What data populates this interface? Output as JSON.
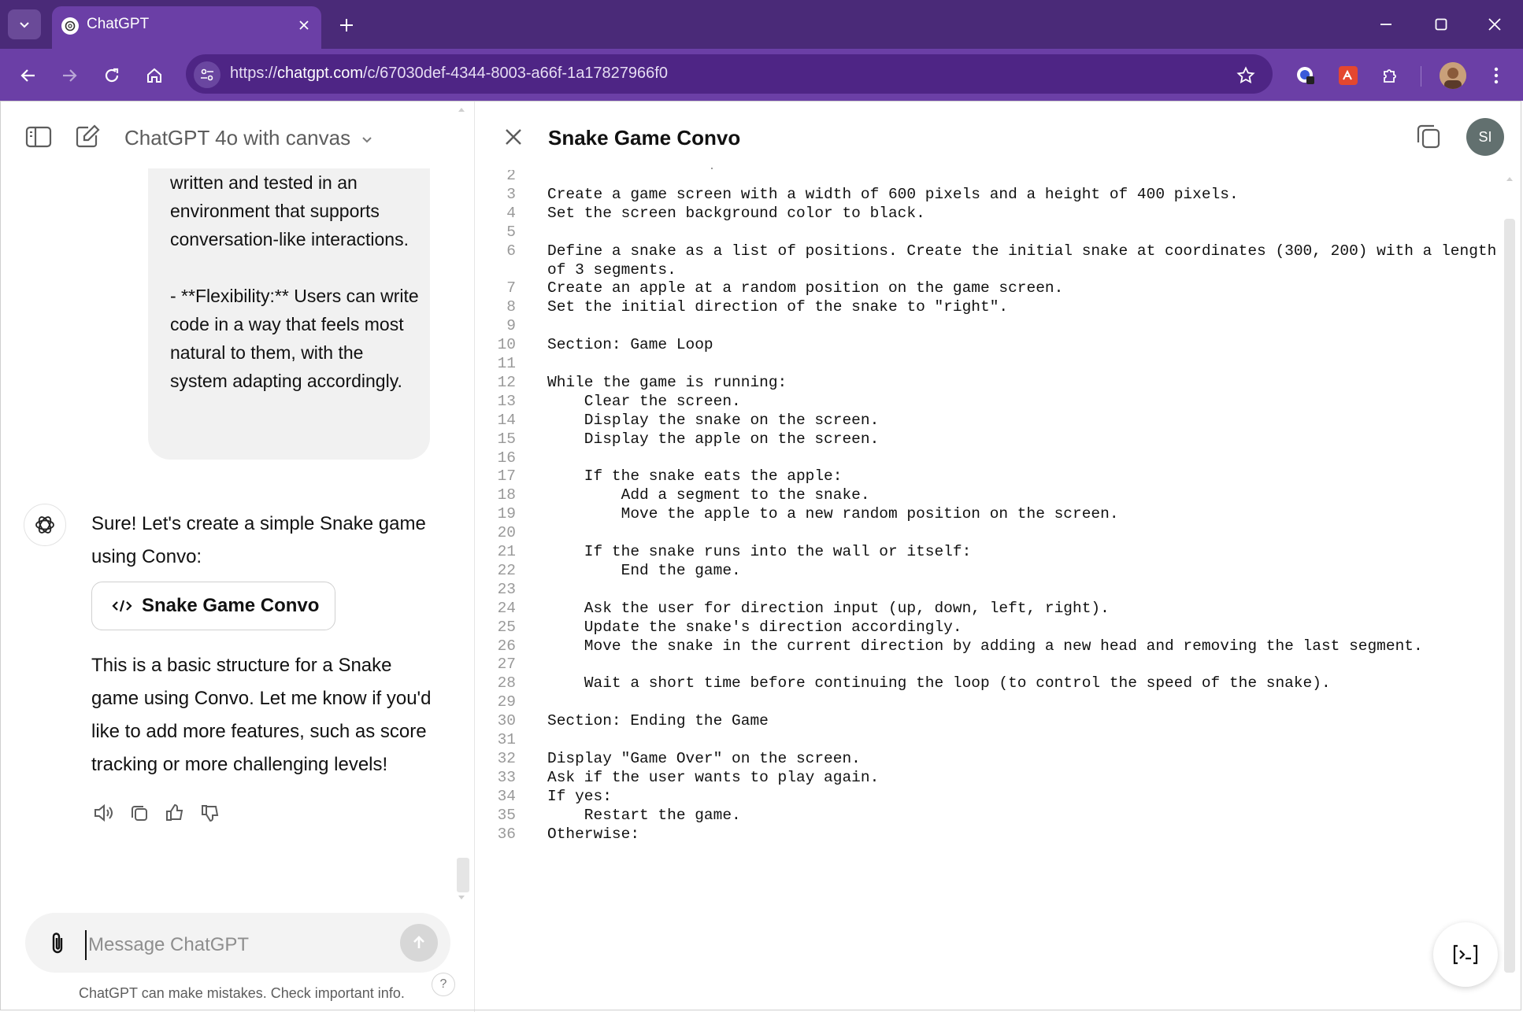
{
  "browser": {
    "tab_title": "ChatGPT",
    "url_prefix": "https://",
    "url_host": "chatgpt.com",
    "url_path": "/c/67030def-4344-8003-a66f-1a17827966f0"
  },
  "chat": {
    "model_title": "ChatGPT 4o with canvas",
    "user_bubble_text": "written and tested in an environment that supports conversation-like interactions.\n\n- **Flexibility:** Users can write code in a way that feels most natural to them, with the system adapting accordingly.",
    "reply_intro": "Sure! Let's create a simple Snake game using Convo:",
    "doc_card_label": "Snake Game Convo",
    "reply_outro": "This is a basic structure for a Snake game using Convo. Let me know if you'd like to add more features, such as score tracking or more challenging levels!",
    "input_placeholder": "Message ChatGPT",
    "disclaimer": "ChatGPT can make mistakes. Check important info.",
    "help_label": "?"
  },
  "canvas": {
    "title": "Snake Game Convo",
    "user_initials": "SI",
    "lines": [
      {
        "n": "2",
        "t": ""
      },
      {
        "n": "3",
        "t": "Create a game screen with a width of 600 pixels and a height of 400 pixels."
      },
      {
        "n": "4",
        "t": "Set the screen background color to black."
      },
      {
        "n": "5",
        "t": ""
      },
      {
        "n": "6",
        "t": "Define a snake as a list of positions. Create the initial snake at coordinates (300, 200) with a length"
      },
      {
        "n": "",
        "t": "of 3 segments."
      },
      {
        "n": "7",
        "t": "Create an apple at a random position on the game screen."
      },
      {
        "n": "8",
        "t": "Set the initial direction of the snake to \"right\"."
      },
      {
        "n": "9",
        "t": ""
      },
      {
        "n": "10",
        "t": "Section: Game Loop"
      },
      {
        "n": "11",
        "t": ""
      },
      {
        "n": "12",
        "t": "While the game is running:"
      },
      {
        "n": "13",
        "t": "    Clear the screen."
      },
      {
        "n": "14",
        "t": "    Display the snake on the screen."
      },
      {
        "n": "15",
        "t": "    Display the apple on the screen."
      },
      {
        "n": "16",
        "t": ""
      },
      {
        "n": "17",
        "t": "    If the snake eats the apple:"
      },
      {
        "n": "18",
        "t": "        Add a segment to the snake."
      },
      {
        "n": "19",
        "t": "        Move the apple to a new random position on the screen."
      },
      {
        "n": "20",
        "t": ""
      },
      {
        "n": "21",
        "t": "    If the snake runs into the wall or itself:"
      },
      {
        "n": "22",
        "t": "        End the game."
      },
      {
        "n": "23",
        "t": ""
      },
      {
        "n": "24",
        "t": "    Ask the user for direction input (up, down, left, right)."
      },
      {
        "n": "25",
        "t": "    Update the snake's direction accordingly."
      },
      {
        "n": "26",
        "t": "    Move the snake in the current direction by adding a new head and removing the last segment."
      },
      {
        "n": "27",
        "t": ""
      },
      {
        "n": "28",
        "t": "    Wait a short time before continuing the loop (to control the speed of the snake)."
      },
      {
        "n": "29",
        "t": ""
      },
      {
        "n": "30",
        "t": "Section: Ending the Game"
      },
      {
        "n": "31",
        "t": ""
      },
      {
        "n": "32",
        "t": "Display \"Game Over\" on the screen."
      },
      {
        "n": "33",
        "t": "Ask if the user wants to play again."
      },
      {
        "n": "34",
        "t": "If yes:"
      },
      {
        "n": "35",
        "t": "    Restart the game."
      },
      {
        "n": "36",
        "t": "Otherwise:"
      }
    ]
  },
  "colors": {
    "browser_frame": "#4a2a78",
    "browser_toolbar": "#6b3fa6",
    "omnibox": "#4e2585",
    "user_bubble": "#f1f1f1",
    "avatar": "#62706f"
  }
}
